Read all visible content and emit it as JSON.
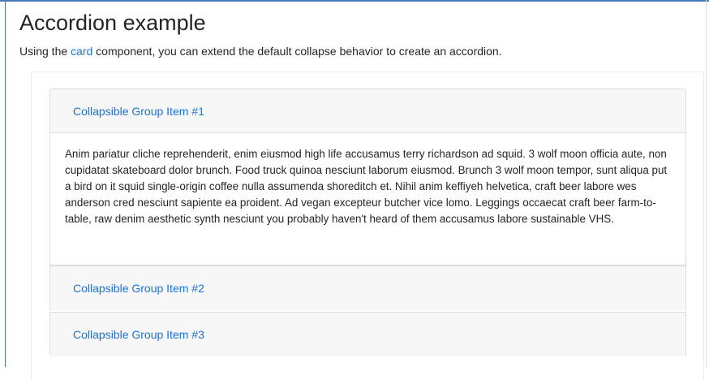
{
  "page": {
    "title": "Accordion example",
    "intro_before": "Using the ",
    "intro_link": "card",
    "intro_after": " component, you can extend the default collapse behavior to create an accordion."
  },
  "accordion": {
    "items": [
      {
        "header": "Collapsible Group Item #1",
        "expanded": true,
        "body": "Anim pariatur cliche reprehenderit, enim eiusmod high life accusamus terry richardson ad squid. 3 wolf moon officia aute, non cupidatat skateboard dolor brunch. Food truck quinoa nesciunt laborum eiusmod. Brunch 3 wolf moon tempor, sunt aliqua put a bird on it squid single-origin coffee nulla assumenda shoreditch et. Nihil anim keffiyeh helvetica, craft beer labore wes anderson cred nesciunt sapiente ea proident. Ad vegan excepteur butcher vice lomo. Leggings occaecat craft beer farm-to-table, raw denim aesthetic synth nesciunt you probably haven't heard of them accusamus labore sustainable VHS."
      },
      {
        "header": "Collapsible Group Item #2",
        "expanded": false
      },
      {
        "header": "Collapsible Group Item #3",
        "expanded": false
      }
    ]
  },
  "colors": {
    "link": "#1a73d9",
    "card_header_bg": "#f7f7f7",
    "card_border": "#dcdcdc",
    "text": "#212529"
  }
}
